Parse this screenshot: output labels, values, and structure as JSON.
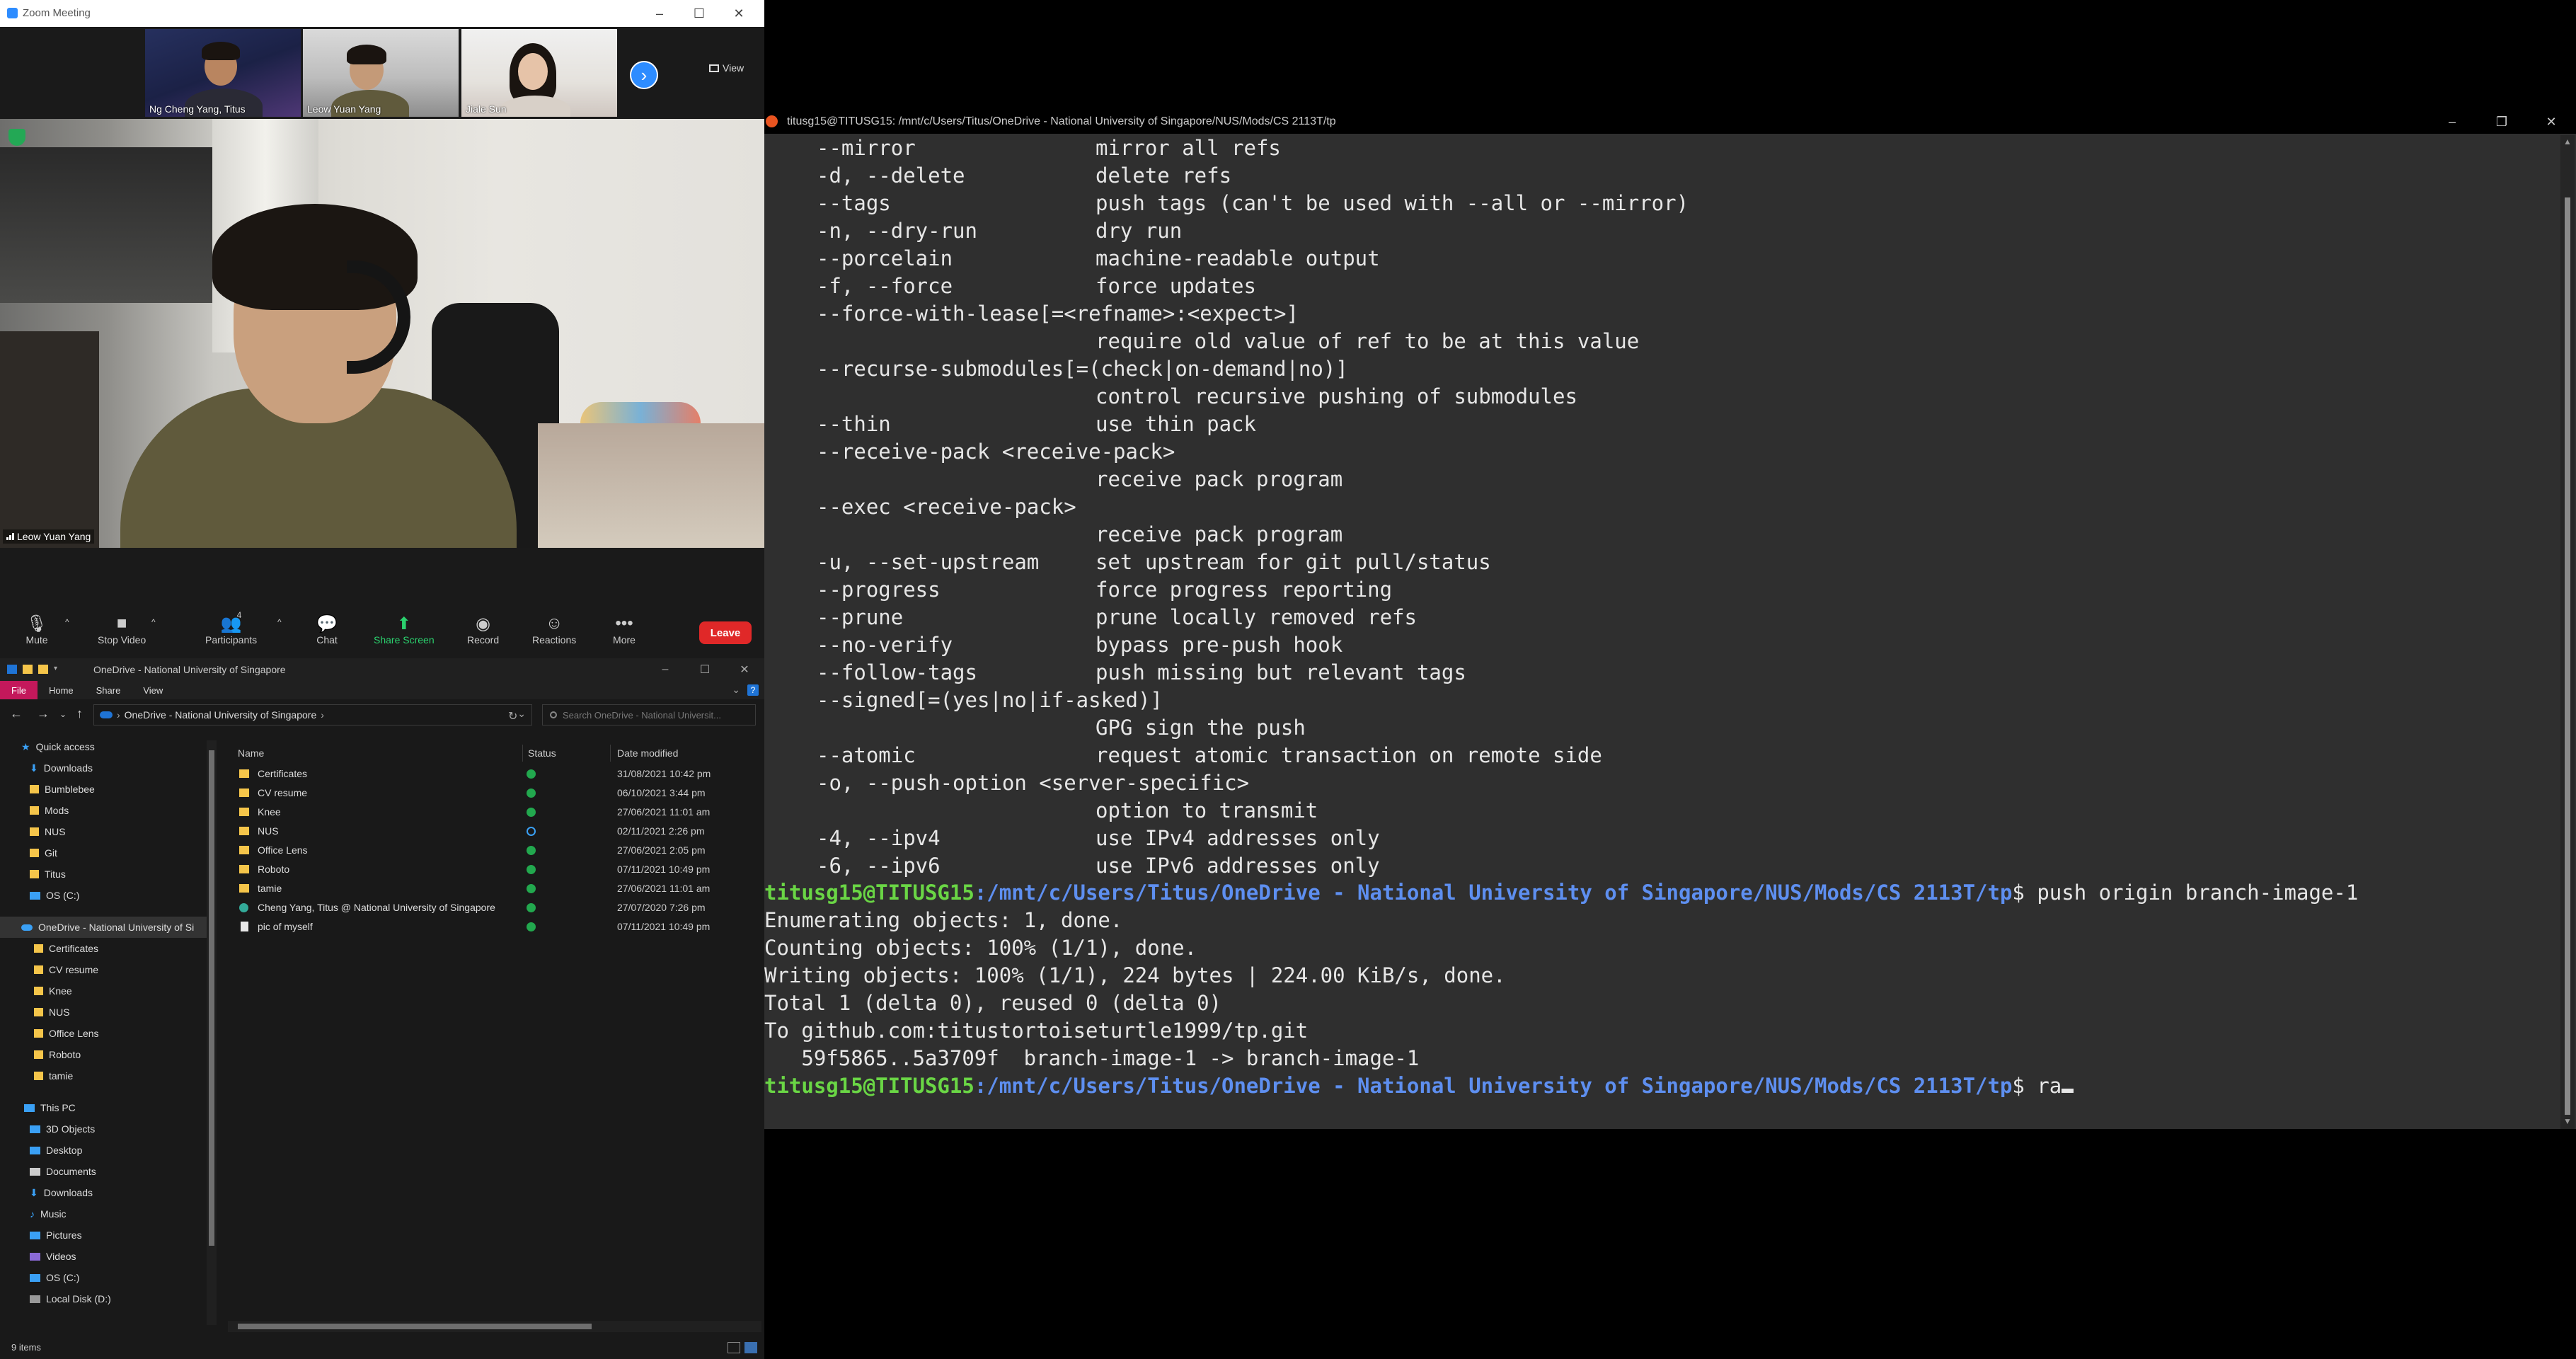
{
  "zoom": {
    "window_title": "Zoom Meeting",
    "participants_gallery": [
      {
        "name": "Ng Cheng Yang, Titus"
      },
      {
        "name": "Leow Yuan Yang"
      },
      {
        "name": "Jiale Sun"
      }
    ],
    "view_label": "View",
    "main_speaker": "Leow Yuan Yang",
    "participant_count": "4",
    "toolbar": {
      "mute": "Mute",
      "stop_video": "Stop Video",
      "participants": "Participants",
      "chat": "Chat",
      "share_screen": "Share Screen",
      "record": "Record",
      "reactions": "Reactions",
      "more": "More",
      "leave": "Leave"
    },
    "colors": {
      "accent": "#2d8cff",
      "share": "#2bd16e",
      "leave": "#e02828"
    }
  },
  "explorer": {
    "window_title": "OneDrive - National University of Singapore",
    "ribbon_tabs": [
      "File",
      "Home",
      "Share",
      "View"
    ],
    "address": {
      "location": "OneDrive - National University of Singapore"
    },
    "search_placeholder": "Search OneDrive - National Universit...",
    "sidebar": {
      "quick_access_label": "Quick access",
      "quick_access": [
        "Downloads",
        "Bumblebee",
        "Mods",
        "NUS",
        "Git",
        "Titus",
        "OS (C:)"
      ],
      "onedrive_label": "OneDrive - National University of Si",
      "onedrive_items": [
        "Certificates",
        "CV resume",
        "Knee",
        "NUS",
        "Office Lens",
        "Roboto",
        "tamie"
      ],
      "this_pc_label": "This PC",
      "this_pc_items": [
        "3D Objects",
        "Desktop",
        "Documents",
        "Downloads",
        "Music",
        "Pictures",
        "Videos",
        "OS (C:)",
        "Local Disk (D:)"
      ]
    },
    "columns": {
      "name": "Name",
      "status": "Status",
      "date": "Date modified"
    },
    "files": [
      {
        "name": "Certificates",
        "date": "31/08/2021 10:42 pm"
      },
      {
        "name": "CV resume",
        "date": "06/10/2021 3:44 pm"
      },
      {
        "name": "Knee",
        "date": "27/06/2021 11:01 am"
      },
      {
        "name": "NUS",
        "date": "02/11/2021 2:26 pm"
      },
      {
        "name": "Office Lens",
        "date": "27/06/2021 2:05 pm"
      },
      {
        "name": "Roboto",
        "date": "07/11/2021 10:49 pm"
      },
      {
        "name": "tamie",
        "date": "27/06/2021 11:01 am"
      },
      {
        "name": "Cheng Yang, Titus @ National University of Singapore",
        "date": "27/07/2020 7:26 pm"
      },
      {
        "name": "pic of myself",
        "date": "07/11/2021 10:49 pm"
      }
    ],
    "status_bar": "9 items"
  },
  "terminal": {
    "window_title": "titusg15@TITUSG15: /mnt/c/Users/Titus/OneDrive - National University of Singapore/NUS/Mods/CS 2113T/tp",
    "options": [
      {
        "flag": "--mirror",
        "desc": "mirror all refs"
      },
      {
        "flag": "-d, --delete",
        "desc": "delete refs"
      },
      {
        "flag": "--tags",
        "desc": "push tags (can't be used with --all or --mirror)"
      },
      {
        "flag": "-n, --dry-run",
        "desc": "dry run"
      },
      {
        "flag": "--porcelain",
        "desc": "machine-readable output"
      },
      {
        "flag": "-f, --force",
        "desc": "force updates"
      },
      {
        "flag": "--force-with-lease[=<refname>:<expect>]",
        "desc": ""
      },
      {
        "flag": "",
        "desc": "require old value of ref to be at this value"
      },
      {
        "flag": "--recurse-submodules[=(check|on-demand|no)]",
        "desc": ""
      },
      {
        "flag": "",
        "desc": "control recursive pushing of submodules"
      },
      {
        "flag": "--thin",
        "desc": "use thin pack"
      },
      {
        "flag": "--receive-pack <receive-pack>",
        "desc": ""
      },
      {
        "flag": "",
        "desc": "receive pack program"
      },
      {
        "flag": "--exec <receive-pack>",
        "desc": ""
      },
      {
        "flag": "",
        "desc": "receive pack program"
      },
      {
        "flag": "-u, --set-upstream",
        "desc": "set upstream for git pull/status"
      },
      {
        "flag": "--progress",
        "desc": "force progress reporting"
      },
      {
        "flag": "--prune",
        "desc": "prune locally removed refs"
      },
      {
        "flag": "--no-verify",
        "desc": "bypass pre-push hook"
      },
      {
        "flag": "--follow-tags",
        "desc": "push missing but relevant tags"
      },
      {
        "flag": "--signed[=(yes|no|if-asked)]",
        "desc": ""
      },
      {
        "flag": "",
        "desc": "GPG sign the push"
      },
      {
        "flag": "--atomic",
        "desc": "request atomic transaction on remote side"
      },
      {
        "flag": "-o, --push-option <server-specific>",
        "desc": ""
      },
      {
        "flag": "",
        "desc": "option to transmit"
      },
      {
        "flag": "-4, --ipv4",
        "desc": "use IPv4 addresses only"
      },
      {
        "flag": "-6, --ipv6",
        "desc": "use IPv6 addresses only"
      }
    ],
    "prompt_user": "titusg15@TITUSG15",
    "prompt_path": ":/mnt/c/Users/Titus/OneDrive - National University of Singapore/NUS/Mods/CS 2113T/tp",
    "command1": "$ push origin branch-image-1",
    "output": [
      "Enumerating objects: 1, done.",
      "Counting objects: 100% (1/1), done.",
      "Writing objects: 100% (1/1), 224 bytes | 224.00 KiB/s, done.",
      "Total 1 (delta 0), reused 0 (delta 0)",
      "To github.com:titustortoiseturtle1999/tp.git",
      "   59f5865..5a3709f  branch-image-1 -> branch-image-1"
    ],
    "command2": "$ ra",
    "colors": {
      "user": "#6ad645",
      "path": "#5e8ff0",
      "background": "#2f2f2f"
    }
  }
}
